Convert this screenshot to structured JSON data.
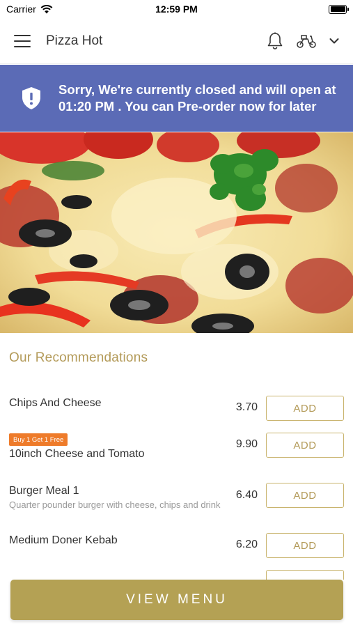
{
  "status_bar": {
    "carrier": "Carrier",
    "time": "12:59 PM"
  },
  "nav": {
    "title": "Pizza Hot",
    "icons": [
      "menu-icon",
      "bell-icon",
      "scooter-icon",
      "chevron-down-icon"
    ]
  },
  "banner": {
    "icon": "shield-alert-icon",
    "message": "Sorry, We're currently closed and will open at 01:20 PM . You can Pre-order now for later",
    "background": "#5b6bb6"
  },
  "recommendations": {
    "title": "Our Recommendations",
    "items": [
      {
        "name": "Chips And Cheese",
        "price": "3.70",
        "button": "ADD"
      },
      {
        "badge": "Buy 1 Get 1 Free",
        "name": "10inch Cheese and Tomato",
        "price": "9.90",
        "button": "ADD"
      },
      {
        "name": "Burger Meal 1",
        "description": "Quarter pounder burger with cheese, chips and drink",
        "price": "6.40",
        "button": "ADD"
      },
      {
        "name": "Medium Doner Kebab",
        "price": "6.20",
        "button": "ADD"
      }
    ]
  },
  "footer": {
    "view_menu_label": "VIEW MENU",
    "accent": "#b4a154"
  }
}
